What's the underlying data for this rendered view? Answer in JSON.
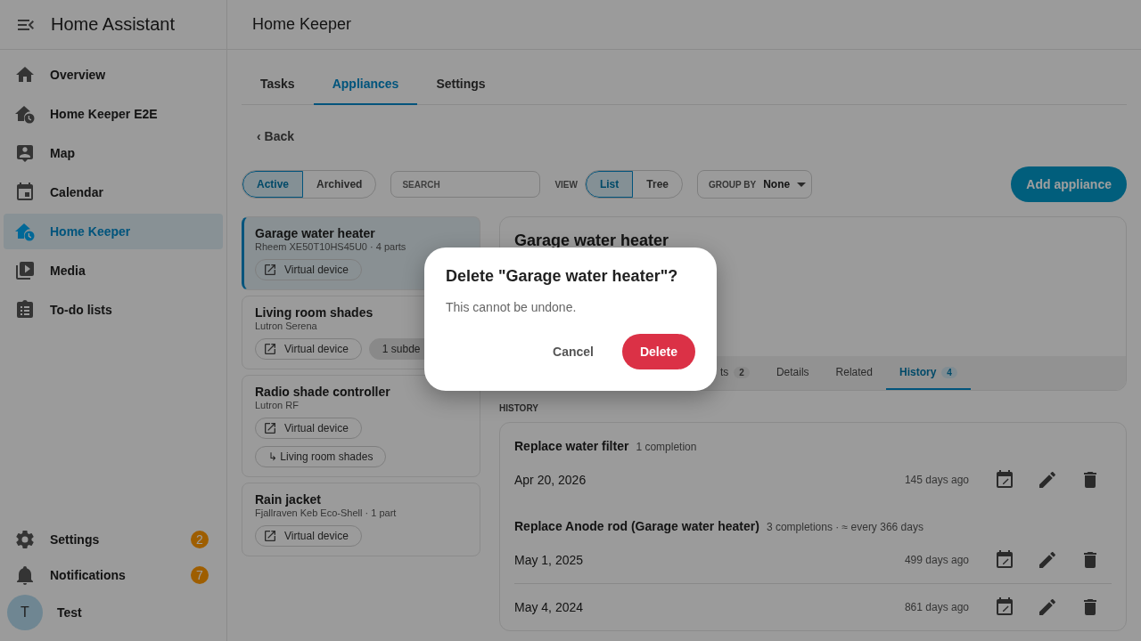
{
  "sidebar": {
    "title": "Home Assistant",
    "items": [
      {
        "label": "Overview",
        "selected": false
      },
      {
        "label": "Home Keeper E2E",
        "selected": false
      },
      {
        "label": "Map",
        "selected": false
      },
      {
        "label": "Calendar",
        "selected": false
      },
      {
        "label": "Home Keeper",
        "selected": true
      },
      {
        "label": "Media",
        "selected": false
      },
      {
        "label": "To-do lists",
        "selected": false
      }
    ],
    "bottom_items": [
      {
        "label": "Settings",
        "badge": "2"
      },
      {
        "label": "Notifications",
        "badge": "7"
      }
    ],
    "user": {
      "initial": "T",
      "name": "Test"
    }
  },
  "header": {
    "title": "Home Keeper"
  },
  "tabs": [
    {
      "label": "Tasks",
      "selected": false
    },
    {
      "label": "Appliances",
      "selected": true
    },
    {
      "label": "Settings",
      "selected": false
    }
  ],
  "back_link": "‹ Back",
  "toolbar": {
    "status_filter": [
      {
        "label": "Active",
        "selected": true
      },
      {
        "label": "Archived",
        "selected": false
      }
    ],
    "search": {
      "placeholder": "SEARCH"
    },
    "view_label": "VIEW",
    "view_options": [
      {
        "label": "List",
        "selected": true
      },
      {
        "label": "Tree",
        "selected": false
      }
    ],
    "group_by": {
      "label": "GROUP BY",
      "value": "None"
    },
    "add_button": "Add appliance"
  },
  "appliances": [
    {
      "name": "Garage water heater",
      "subtitle": "Rheem XE50T10HS45U0 · 4 parts",
      "selected": true,
      "chips": [
        {
          "kind": "device",
          "label": "Virtual device"
        }
      ]
    },
    {
      "name": "Living room shades",
      "subtitle": "Lutron Serena",
      "selected": false,
      "chips": [
        {
          "kind": "device",
          "label": "Virtual device"
        },
        {
          "kind": "filled",
          "label": "1 subde"
        }
      ]
    },
    {
      "name": "Radio shade controller",
      "subtitle": "Lutron RF",
      "selected": false,
      "chips": [
        {
          "kind": "device",
          "label": "Virtual device"
        },
        {
          "kind": "parent",
          "label": "↳ Living room shades"
        }
      ]
    },
    {
      "name": "Rain jacket",
      "subtitle": "Fjallraven Keb Eco-Shell · 1 part",
      "selected": false,
      "chips": [
        {
          "kind": "device",
          "label": "Virtual device"
        }
      ]
    }
  ],
  "detail": {
    "title": "Garage water heater",
    "tabs": [
      {
        "label": "ts",
        "count": "2",
        "selected": false
      },
      {
        "label": "Details",
        "selected": false
      },
      {
        "label": "Related",
        "selected": false
      },
      {
        "label": "History",
        "count": "4",
        "selected": true
      }
    ],
    "section_label": "HISTORY",
    "history": [
      {
        "task": "Replace water filter",
        "meta": "1 completion",
        "entries": [
          {
            "date": "Apr 20, 2026",
            "ago": "145 days ago"
          }
        ]
      },
      {
        "task": "Replace Anode rod (Garage water heater)",
        "meta": "3 completions · ≈ every 366 days",
        "entries": [
          {
            "date": "May 1, 2025",
            "ago": "499 days ago"
          },
          {
            "date": "May 4, 2024",
            "ago": "861 days ago"
          }
        ]
      }
    ]
  },
  "dialog": {
    "title": "Delete \"Garage water heater\"?",
    "message": "This cannot be undone.",
    "buttons": [
      {
        "label": "Cancel",
        "kind": "text"
      },
      {
        "label": "Delete",
        "kind": "danger"
      }
    ]
  }
}
